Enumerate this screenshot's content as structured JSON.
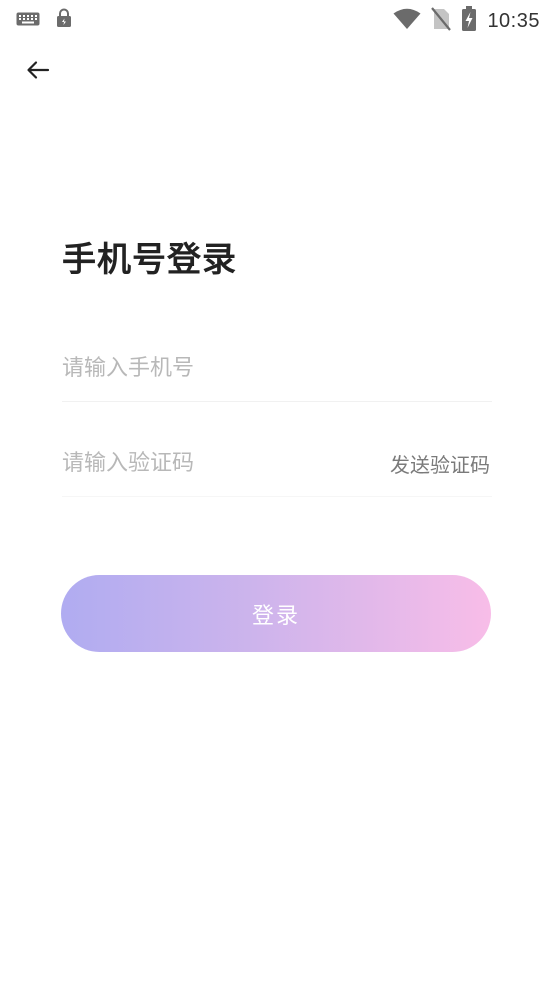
{
  "status_bar": {
    "time": "10:35",
    "icons": [
      "keyboard-icon",
      "lock-icon",
      "wifi-icon",
      "no-sim-icon",
      "battery-charging-icon"
    ]
  },
  "header": {
    "back_icon": "arrow-left-icon"
  },
  "page": {
    "title": "手机号登录"
  },
  "form": {
    "phone": {
      "value": "",
      "placeholder": "请输入手机号"
    },
    "code": {
      "value": "",
      "placeholder": "请输入验证码",
      "send_label": "发送验证码"
    },
    "login_label": "登录"
  },
  "colors": {
    "login_gradient_start": "#b0acf1",
    "login_gradient_end": "#f8bde8",
    "title": "#222222",
    "placeholder": "#b8b8b8"
  }
}
